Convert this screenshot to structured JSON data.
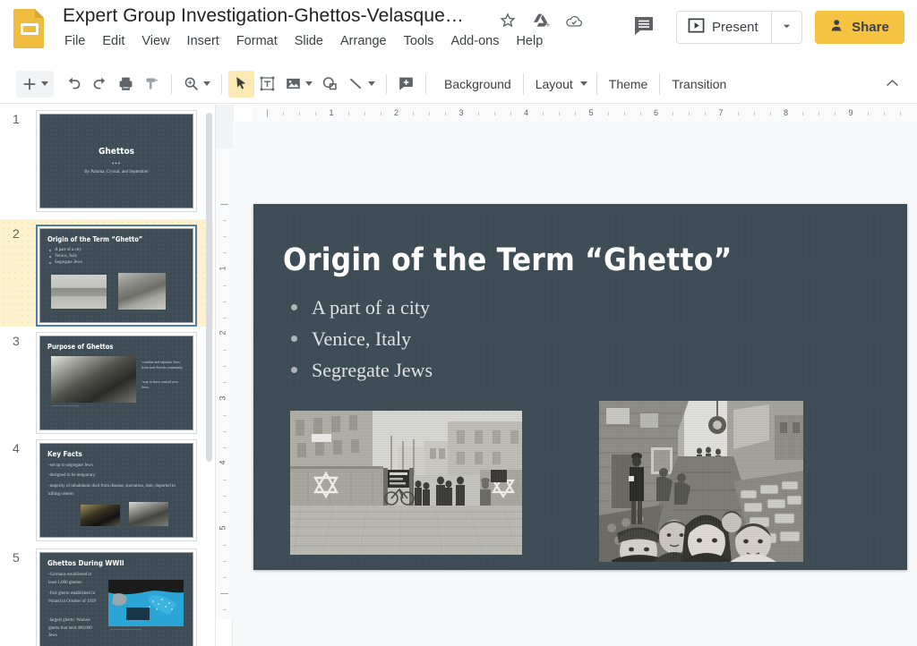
{
  "app": {
    "name": "Google Slides",
    "logo_icon": "slides-logo-icon",
    "document_title": "Expert Group Investigation-Ghettos-Velasque…",
    "title_icons": [
      {
        "name": "star-icon",
        "label": "Star"
      },
      {
        "name": "move-to-drive-icon",
        "label": "Move to Drive"
      },
      {
        "name": "cloud-saved-icon",
        "label": "See document status"
      }
    ],
    "accent_color": "#f5c242",
    "text_color": "#3c4043"
  },
  "menubar": {
    "items": [
      "File",
      "Edit",
      "View",
      "Insert",
      "Format",
      "Slide",
      "Arrange",
      "Tools",
      "Add-ons",
      "Help"
    ]
  },
  "header_actions": {
    "comment_icon": "comment-history-icon",
    "present_label": "Present",
    "present_icon": "present-play-icon",
    "present_dropdown_icon": "chevron-down-icon",
    "share_label": "Share",
    "share_icon": "person-add-icon"
  },
  "toolbar": {
    "items": [
      {
        "name": "new-slide-button",
        "icon": "plus-icon",
        "has_dropdown": true,
        "highlighted": true
      },
      {
        "name": "undo-button",
        "icon": "undo-icon"
      },
      {
        "name": "redo-button",
        "icon": "redo-icon"
      },
      {
        "name": "print-button",
        "icon": "print-icon"
      },
      {
        "name": "paint-format-button",
        "icon": "paint-roller-icon"
      },
      {
        "name": "zoom-button",
        "icon": "magnifier-plus-icon",
        "has_dropdown": true
      },
      {
        "name": "select-tool-button",
        "icon": "cursor-arrow-icon",
        "active": true
      },
      {
        "name": "text-box-button",
        "icon": "text-box-icon"
      },
      {
        "name": "insert-image-button",
        "icon": "image-icon",
        "has_dropdown": true
      },
      {
        "name": "shape-button",
        "icon": "shape-icon"
      },
      {
        "name": "line-button",
        "icon": "line-icon",
        "has_dropdown": true
      },
      {
        "name": "add-comment-button",
        "icon": "comment-plus-icon"
      }
    ],
    "text_buttons": [
      {
        "name": "background-button",
        "label": "Background"
      },
      {
        "name": "layout-button",
        "label": "Layout",
        "has_dropdown": true
      },
      {
        "name": "theme-button",
        "label": "Theme"
      },
      {
        "name": "transition-button",
        "label": "Transition"
      }
    ],
    "collapse_icon": "chevron-up-icon"
  },
  "rulers": {
    "horizontal_ticks": [
      "1",
      "2",
      "3",
      "4",
      "5",
      "6",
      "7",
      "8",
      "9"
    ],
    "vertical_ticks": [
      "1",
      "2",
      "3",
      "4",
      "5"
    ],
    "unit": "inches"
  },
  "filmstrip": {
    "selected_index": 2,
    "slides": [
      {
        "number": "1",
        "layout": "title",
        "title": "Ghettos",
        "divider": "•••",
        "subtitle": "By Paloma, Crystal, and September"
      },
      {
        "number": "2",
        "layout": "title-body-images",
        "title": "Origin of the Term “Ghetto”",
        "bullets": [
          "A part of a city",
          "Venice, Italy",
          "Segregate Jews"
        ],
        "images": [
          "ghetto-street-entrance-photo",
          "children-in-alley-photo"
        ]
      },
      {
        "number": "3",
        "layout": "title-image-body",
        "title": "Purpose of Ghettos",
        "bullets": [
          "-confine and separate Jews from non-Jewish community",
          "-way to have control over Jews"
        ],
        "images": [
          "nazi-soldiers-crowd-photo"
        ],
        "caption": "http://www.example.com/photo.jpg"
      },
      {
        "number": "4",
        "layout": "title-body-images",
        "title": "Key Facts",
        "bullets": [
          "-set up to segregate Jews",
          "-designed to be temporary",
          "-majority of inhabitants died from disease, starvation, shot, deported to killing centers"
        ],
        "images": [
          "crowd-photo-dark",
          "ghetto-street-photo"
        ]
      },
      {
        "number": "5",
        "layout": "title-body-map",
        "title": "Ghettos During WWII",
        "bullets": [
          "-Germans established at least 1,000 ghettos",
          "-first ghetto established in Poland in October of 1939",
          "-largest ghetto: Warsaw ghetto that held 400,000 Jews"
        ],
        "images": [
          "europe-ghettos-map"
        ],
        "caption": "http://www.ushmm.org/ghettos-map.jpg"
      }
    ]
  },
  "current_slide": {
    "title": "Origin of the Term “Ghetto”",
    "bullets": [
      "A part of a city",
      "Venice, Italy",
      "Segregate Jews"
    ],
    "background_color": "#3d4c55",
    "title_color": "#ffffff",
    "body_color": "#dfe3e5",
    "images": [
      {
        "name": "ghetto-street-entrance-photo",
        "alt": "Black and white photo of a ghetto entrance wall marked with Star of David"
      },
      {
        "name": "children-in-alley-photo",
        "alt": "Black and white photo of children in a ghetto alley"
      }
    ]
  }
}
